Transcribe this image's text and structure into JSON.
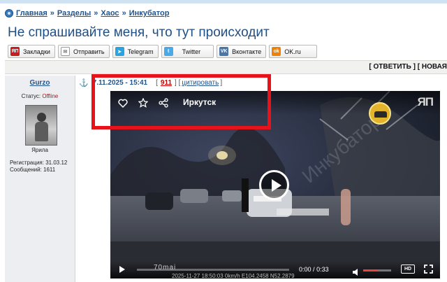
{
  "breadcrumb": {
    "items": [
      "Главная",
      "Разделы",
      "Хаос",
      "Инкубатор"
    ],
    "separator": "»"
  },
  "page_title": "Не спрашивайте меня, что тут происходит",
  "share_buttons": [
    {
      "label": "Закладки",
      "icon": "yap-icon",
      "color": "#c41e1e",
      "glyph": "ЯП"
    },
    {
      "label": "Отправить",
      "icon": "envelope-icon",
      "color": "#7a7a7a",
      "glyph": "✉"
    },
    {
      "label": "Telegram",
      "icon": "telegram-icon",
      "color": "#2aa3df",
      "glyph": "➤"
    },
    {
      "label": "Twitter",
      "icon": "twitter-icon",
      "color": "#4aa9e6",
      "glyph": "t"
    },
    {
      "label": "Вконтакте",
      "icon": "vk-icon",
      "color": "#4a76a8",
      "glyph": "VK"
    },
    {
      "label": "OK.ru",
      "icon": "ok-icon",
      "color": "#ee8208",
      "glyph": "ok"
    }
  ],
  "post_actions": {
    "reply": "ОТВЕТИТЬ",
    "new": "НОВАЯ"
  },
  "author": {
    "name": "Gurzo",
    "status_label": "Статус:",
    "status_value": "Offline",
    "nick": "Ярила",
    "registration": "Регистрация: 31.03.12",
    "messages": "Сообщений: 1611"
  },
  "post": {
    "date": "7.11.2025 - 15:41",
    "number": "911",
    "quote_label": "цитировать"
  },
  "video": {
    "location": "Иркутск",
    "brand": "ЯП",
    "time_current": "0:00",
    "time_total": "0:33",
    "separator": "/",
    "hd_label": "HD",
    "logo_text": "70mai",
    "dash_text": "2025-11-27 18:50:03      0km/h E104.2458 N52.2879",
    "volume": 0.55,
    "progress": 0.0
  },
  "colors": {
    "link": "#22538b",
    "offline": "#bb1111",
    "post_number": "#cc0000",
    "highlight_box": "#e8121a",
    "volume_accent": "#e8463c"
  }
}
